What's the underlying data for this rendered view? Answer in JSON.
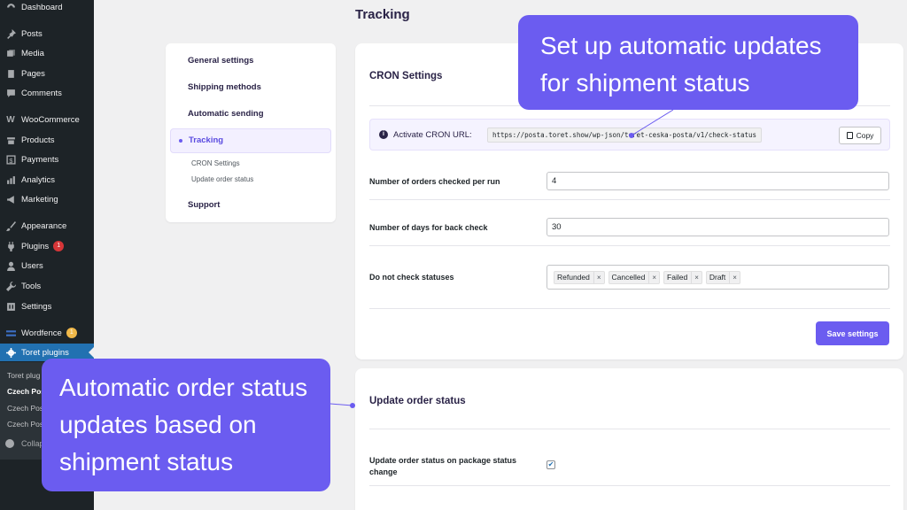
{
  "sidebar": {
    "items": [
      {
        "label": "Dashboard",
        "icon": "dashboard-icon"
      },
      {
        "label": "Posts",
        "icon": "pin-icon"
      },
      {
        "label": "Media",
        "icon": "media-icon"
      },
      {
        "label": "Pages",
        "icon": "pages-icon"
      },
      {
        "label": "Comments",
        "icon": "comment-icon"
      },
      {
        "label": "WooCommerce",
        "icon": "woocommerce-icon"
      },
      {
        "label": "Products",
        "icon": "archive-icon"
      },
      {
        "label": "Payments",
        "icon": "dollar-icon"
      },
      {
        "label": "Analytics",
        "icon": "bar-chart-icon"
      },
      {
        "label": "Marketing",
        "icon": "megaphone-icon"
      },
      {
        "label": "Appearance",
        "icon": "brush-icon"
      },
      {
        "label": "Plugins",
        "icon": "plug-icon",
        "badge": "1"
      },
      {
        "label": "Users",
        "icon": "user-icon"
      },
      {
        "label": "Tools",
        "icon": "wrench-icon"
      },
      {
        "label": "Settings",
        "icon": "settings-icon"
      },
      {
        "label": "Wordfence",
        "icon": "wordfence-icon",
        "badge": "1"
      },
      {
        "label": "Toret plugins",
        "icon": "gear-icon"
      }
    ],
    "submenu": [
      "Toret plug",
      "Czech Post",
      "Czech Post",
      "Czech Post"
    ],
    "collapse_label": "Collap"
  },
  "page_title": "Tracking",
  "settings_nav": {
    "items": [
      "General settings",
      "Shipping methods",
      "Automatic sending",
      "Tracking",
      "Support"
    ],
    "subitems": [
      "CRON Settings",
      "Update order status"
    ]
  },
  "cron": {
    "title": "CRON Settings",
    "activate_label": "Activate CRON URL:",
    "url": "https://posta.toret.show/wp-json/toret-ceska-posta/v1/check-status",
    "copy_label": "Copy",
    "orders_label": "Number of orders checked per run",
    "orders_value": "4",
    "days_label": "Number of days for back check",
    "days_value": "30",
    "statuses_label": "Do not check statuses",
    "statuses": [
      "Refunded",
      "Cancelled",
      "Failed",
      "Draft"
    ],
    "save_label": "Save settings"
  },
  "update_status": {
    "title": "Update order status",
    "checkbox_label": "Update order status on package status change",
    "checked": true
  },
  "callouts": {
    "top": "Set up automatic updates for shipment status",
    "bottom": "Automatic order status updates based on shipment status"
  },
  "colors": {
    "accent": "#6b5cf0",
    "wp_sidebar": "#1d2327",
    "wp_active": "#2271b1"
  }
}
